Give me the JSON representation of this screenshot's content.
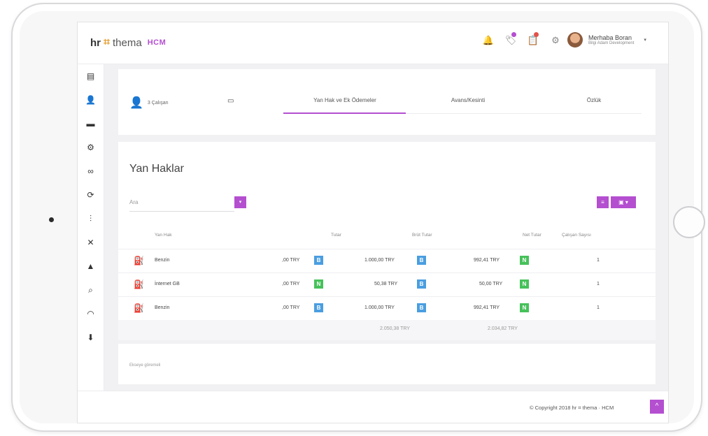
{
  "brand": {
    "hr": "hr",
    "mark": "⌗",
    "thema": "thema",
    "hcm": "HCM",
    "accent": "#b44fd0"
  },
  "header": {
    "user_name": "Merhaba Boran",
    "user_role": "Bilgi Adam Development",
    "caret": "▾",
    "icons": [
      {
        "name": "bell-icon",
        "glyph": "🔔",
        "dot": ""
      },
      {
        "name": "tag-icon",
        "glyph": "🏷",
        "dot": "#b44fd0"
      },
      {
        "name": "clipboard-icon",
        "glyph": "📋",
        "dot": "#e2524a"
      },
      {
        "name": "gear-icon",
        "glyph": "⚙",
        "dot": ""
      }
    ]
  },
  "sidebar": {
    "items": [
      {
        "name": "sidebar-item-documents",
        "icon": "documents-icon",
        "glyph": "▤"
      },
      {
        "name": "sidebar-item-users",
        "icon": "user-icon",
        "glyph": "👤"
      },
      {
        "name": "sidebar-item-folders",
        "icon": "folder-icon",
        "glyph": "▬"
      },
      {
        "name": "sidebar-item-settings",
        "icon": "gear-icon",
        "glyph": "⚙"
      },
      {
        "name": "sidebar-item-glasses",
        "icon": "glasses-icon",
        "glyph": "∞"
      },
      {
        "name": "sidebar-item-cycle",
        "icon": "cycle-icon",
        "glyph": "⟳"
      },
      {
        "name": "sidebar-item-organization",
        "icon": "hierarchy-icon",
        "glyph": "⫶"
      },
      {
        "name": "sidebar-item-tools",
        "icon": "wrench-icon",
        "glyph": "✕"
      },
      {
        "name": "sidebar-item-education",
        "icon": "graduation-cap-icon",
        "glyph": "▲"
      },
      {
        "name": "sidebar-item-search",
        "icon": "search-icon",
        "glyph": "⌕"
      },
      {
        "name": "sidebar-item-dashboard",
        "icon": "gauge-icon",
        "glyph": "◠"
      },
      {
        "name": "sidebar-item-download",
        "icon": "download-icon",
        "glyph": "⬇"
      }
    ]
  },
  "tabs_card": {
    "employee_label": "3 Çalışan",
    "tabs": [
      "Yan Hak ve Ek Ödemeler",
      "Avans/Kesinti",
      "Özlük"
    ]
  },
  "main": {
    "title": "Yan Haklar",
    "search_placeholder": "Ara",
    "search_btn": "▾",
    "action1": "≡",
    "action2": "▣ ▾",
    "columns": [
      "Yan Hak",
      "Tutar",
      "Brüt Tutar",
      "Net Tutar",
      "Çalışan Sayısı"
    ],
    "rows": [
      {
        "name": "Benzin",
        "tutar": ",00 TRY",
        "tutar_badge": "B",
        "brut": "1.000,00 TRY",
        "brut_badge": "B",
        "net": "992,41 TRY",
        "net_badge": "N",
        "count": "1"
      },
      {
        "name": "İnternet GB",
        "tutar": ",00 TRY",
        "tutar_badge": "N",
        "brut": "50,38 TRY",
        "brut_badge": "B",
        "net": "50,00 TRY",
        "net_badge": "N",
        "count": "1"
      },
      {
        "name": "Benzin",
        "tutar": ",00 TRY",
        "tutar_badge": "B",
        "brut": "1.000,00 TRY",
        "brut_badge": "B",
        "net": "992,41 TRY",
        "net_badge": "N",
        "count": "1"
      }
    ],
    "totals": {
      "brut": "2.050,38 TRY",
      "net": "2.034,82 TRY"
    }
  },
  "notes": {
    "text": "Ekseye göremeli"
  },
  "footer": {
    "text": "© Copyright 2018  hr ⌗ thema · HCM",
    "to_top": "^"
  }
}
